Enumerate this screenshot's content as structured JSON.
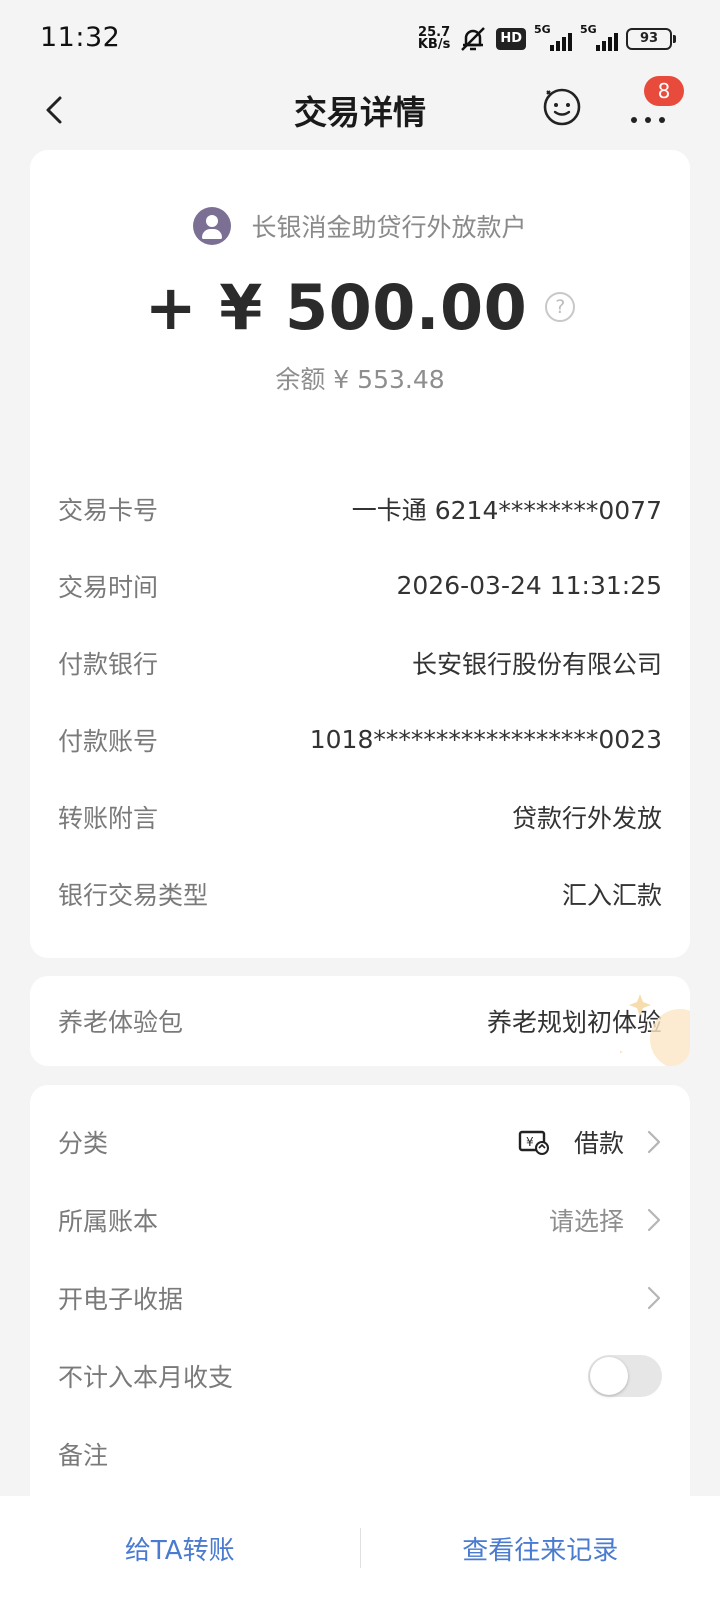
{
  "status_bar": {
    "time": "11:32",
    "net_speed_top": "25.7",
    "net_speed_bottom": "KB/s",
    "hd": "HD",
    "sim1": "5G",
    "sim2": "5G",
    "battery": "93"
  },
  "nav": {
    "title": "交易详情",
    "badge": "8",
    "icons": [
      "back-icon",
      "customer-service-icon",
      "more-icon"
    ]
  },
  "summary": {
    "payee": "长银消金助贷行外放款户",
    "amount": "+ ¥ 500.00",
    "help_icon": "?",
    "balance": "余额 ¥ 553.48"
  },
  "details": [
    {
      "label": "交易卡号",
      "value": "一卡通 6214********0077"
    },
    {
      "label": "交易时间",
      "value": "2026-03-24 11:31:25"
    },
    {
      "label": "付款银行",
      "value": "长安银行股份有限公司"
    },
    {
      "label": "付款账号",
      "value": "1018******************0023"
    },
    {
      "label": "转账附言",
      "value": "贷款行外发放"
    },
    {
      "label": "银行交易类型",
      "value": "汇入汇款"
    }
  ],
  "pension": {
    "label": "养老体验包",
    "value": "养老规划初体验"
  },
  "category_section": {
    "category_label": "分类",
    "category_value": "借款",
    "ledger_label": "所属账本",
    "ledger_placeholder": "请选择",
    "receipt_label": "开电子收据",
    "exclude_label": "不计入本月收支",
    "exclude_checked": false,
    "note_label": "备注"
  },
  "bottom": {
    "transfer_label": "给TA转账",
    "history_label": "查看往来记录"
  },
  "colors": {
    "accent_blue": "#4a7bd0",
    "badge_red": "#e84b3c",
    "avatar_purple": "#7b6f94"
  }
}
